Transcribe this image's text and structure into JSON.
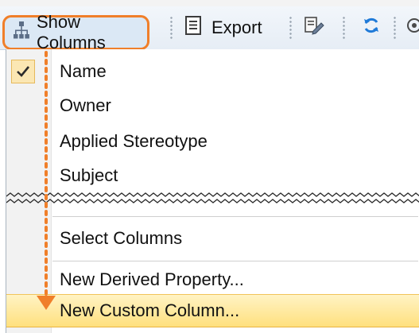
{
  "toolbar": {
    "show_columns_label": "Show Columns",
    "export_label": "Export",
    "icons": {
      "show_columns": "column-tree-icon",
      "export": "export-document-icon",
      "tool3": "edit-document-icon",
      "refresh": "refresh-icon",
      "tool5": "target-icon"
    },
    "highlight_color": "#F07F2A"
  },
  "menu": {
    "items": [
      {
        "label": "Name",
        "checked": true
      },
      {
        "label": "Owner",
        "checked": false
      },
      {
        "label": "Applied Stereotype",
        "checked": false
      },
      {
        "label": "Subject",
        "checked": false
      }
    ],
    "actions": [
      {
        "label": "Select Columns"
      },
      {
        "label": "New Derived Property..."
      },
      {
        "label": "New Custom Column...",
        "highlighted": true
      }
    ],
    "highlight_color": "#FFE07E"
  },
  "annotation": {
    "arrow_color": "#F07F2A"
  }
}
